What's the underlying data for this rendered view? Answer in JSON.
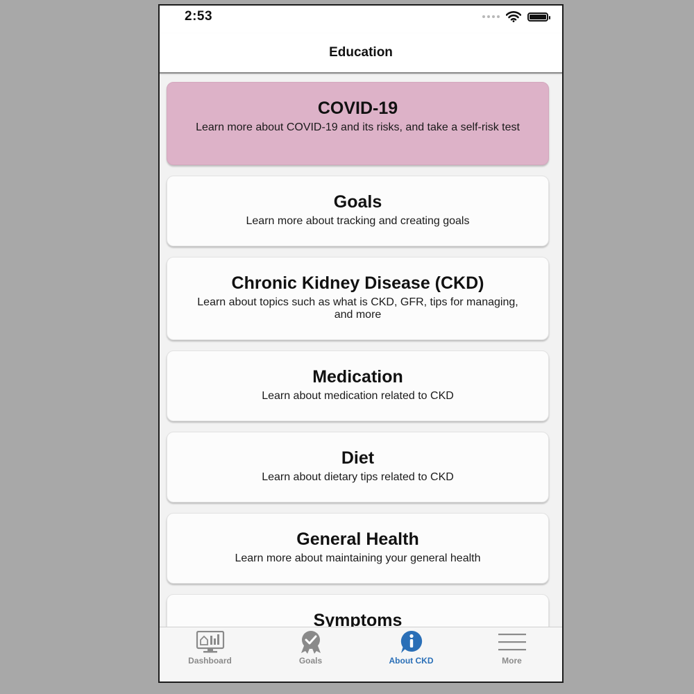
{
  "status_bar": {
    "time": "2:53"
  },
  "header": {
    "title": "Education"
  },
  "cards": [
    {
      "title": "COVID-19",
      "description": "Learn more about COVID-19 and its risks, and take a self-risk test",
      "highlighted": true,
      "color": "#ddb2c8"
    },
    {
      "title": "Goals",
      "description": "Learn more about tracking and creating goals"
    },
    {
      "title": "Chronic Kidney Disease (CKD)",
      "description": "Learn about topics such as what is CKD, GFR, tips for managing, and more"
    },
    {
      "title": "Medication",
      "description": "Learn about medication related to CKD"
    },
    {
      "title": "Diet",
      "description": "Learn about dietary tips related to CKD"
    },
    {
      "title": "General Health",
      "description": "Learn more about maintaining your general health"
    },
    {
      "title": "Symptoms",
      "description": ""
    }
  ],
  "tabs": [
    {
      "label": "Dashboard",
      "icon": "dashboard-icon"
    },
    {
      "label": "Goals",
      "icon": "goals-badge-icon"
    },
    {
      "label": "About CKD",
      "icon": "info-icon",
      "active": true
    },
    {
      "label": "More",
      "icon": "menu-icon"
    }
  ],
  "colors": {
    "accent": "#2a6fb7",
    "highlight_card": "#ddb2c8",
    "inactive_tab": "#8a8a8a"
  }
}
